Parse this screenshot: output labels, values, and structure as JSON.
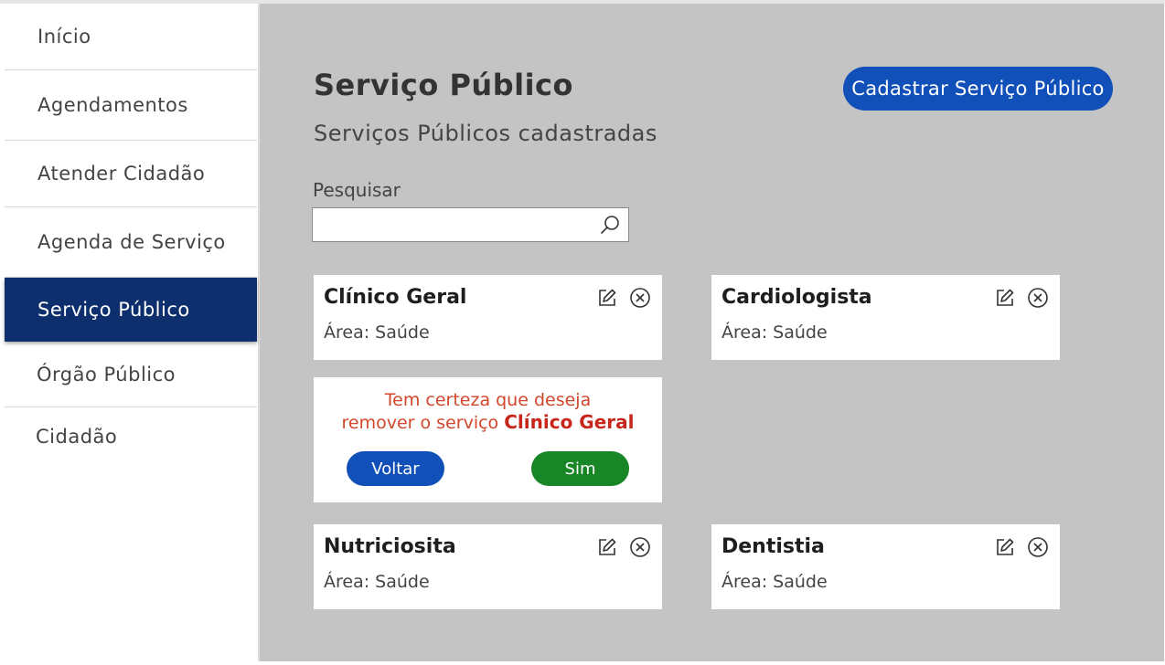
{
  "sidebar": {
    "items": [
      {
        "label": "Início"
      },
      {
        "label": "Agendamentos"
      },
      {
        "label": "Atender Cidadão"
      },
      {
        "label": "Agenda de Serviço"
      },
      {
        "label": "Serviço Público",
        "active": true
      },
      {
        "label": "Órgão Público"
      },
      {
        "label": "Cidadão"
      }
    ],
    "active_color": "#0e2f6e"
  },
  "header": {
    "title": "Serviço Público",
    "subtitle": "Serviços Públicos cadastradas",
    "create_button": "Cadastrar Serviço Público"
  },
  "search": {
    "label": "Pesquisar",
    "value": "",
    "placeholder": ""
  },
  "cards": [
    {
      "title": "Clínico Geral",
      "area": "Área: Saúde",
      "icons": [
        "edit-icon",
        "remove-icon"
      ]
    },
    {
      "title": "Cardiologista",
      "area": "Área: Saúde",
      "icons": [
        "edit-icon",
        "remove-icon"
      ]
    },
    {
      "title": "Nutriciosita",
      "area": "Área: Saúde",
      "icons": [
        "edit-icon",
        "remove-icon"
      ]
    },
    {
      "title": "Dentistia",
      "area": "Área: Saúde",
      "icons": [
        "edit-icon",
        "remove-icon"
      ]
    }
  ],
  "confirm": {
    "line1": "Tem certeza que deseja",
    "line2_prefix": "remover o serviço",
    "service_name": "Clínico Geral",
    "back_button": "Voltar",
    "yes_button": "Sim"
  },
  "colors": {
    "primary": "#1150b8",
    "success": "#188527",
    "danger": "#c8261b",
    "main_bg": "#c4c4c4"
  }
}
